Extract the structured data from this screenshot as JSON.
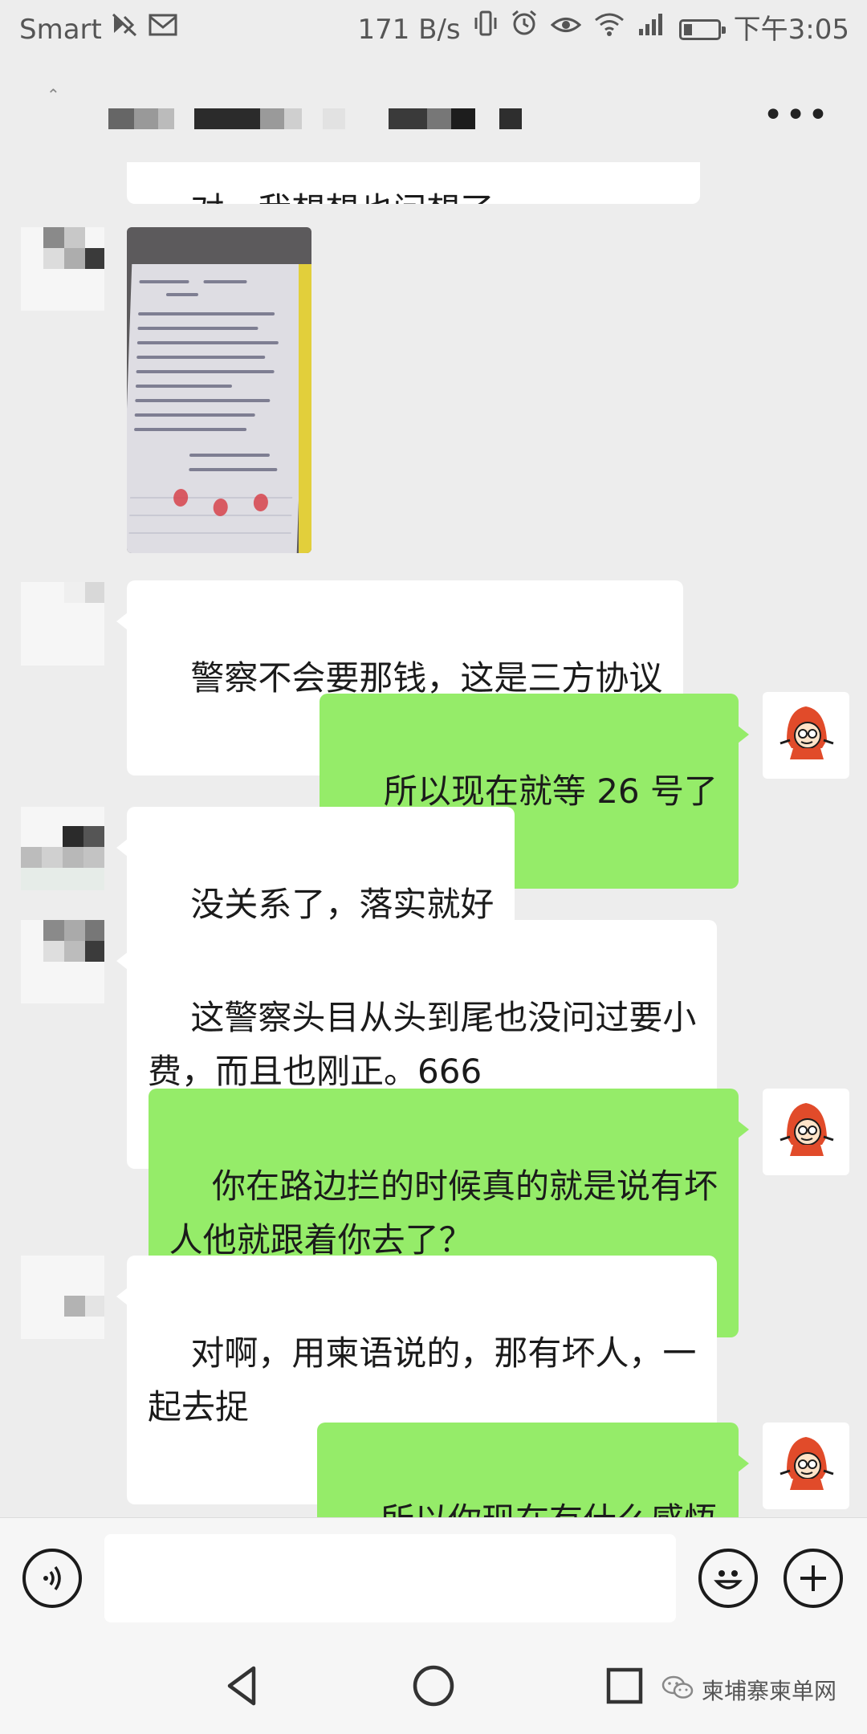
{
  "status_bar": {
    "carrier": "Smart",
    "net_speed": "171 B/s",
    "time": "下午3:05",
    "icons": [
      "mute-icon",
      "mail-icon",
      "vibrate-icon",
      "alarm-icon",
      "eye-icon",
      "wifi-icon",
      "signal-icon",
      "battery-icon"
    ]
  },
  "title_bar": {
    "more_label": "•••",
    "contact_name_redacted": true
  },
  "messages": [
    {
      "side": "in",
      "text": "对，我想想也问想了",
      "clipped": true
    },
    {
      "side": "in",
      "type": "image",
      "alt": "photo of handwritten agreement with red thumbprints"
    },
    {
      "side": "in",
      "text": "警察不会要那钱，这是三方协议"
    },
    {
      "side": "out",
      "text": "所以现在就等 26 号了"
    },
    {
      "side": "in",
      "text": "没关系了，落实就好"
    },
    {
      "side": "in",
      "text": "这警察头目从头到尾也没问过要小\n费，而且也刚正。666"
    },
    {
      "side": "out",
      "text": "你在路边拦的时候真的就是说有坏\n人他就跟着你去了？"
    },
    {
      "side": "in",
      "text": "对啊，用柬语说的，那有坏人，一\n起去捉"
    },
    {
      "side": "out",
      "text": "所以你现在有什么感悟"
    }
  ],
  "input_bar": {
    "voice_icon": "voice-icon",
    "input_value": "",
    "emoji_icon": "emoji-icon",
    "plus_icon": "plus-icon"
  },
  "nav_bar": {
    "icons": [
      "back-triangle-icon",
      "home-circle-icon",
      "recents-square-icon"
    ]
  },
  "watermark": {
    "text": "柬埔寨柬单网",
    "icon": "wechat-icon"
  },
  "colors": {
    "background": "#ededed",
    "bubble_out": "#95ec69",
    "bubble_in": "#ffffff",
    "text": "#1b1b1b"
  }
}
